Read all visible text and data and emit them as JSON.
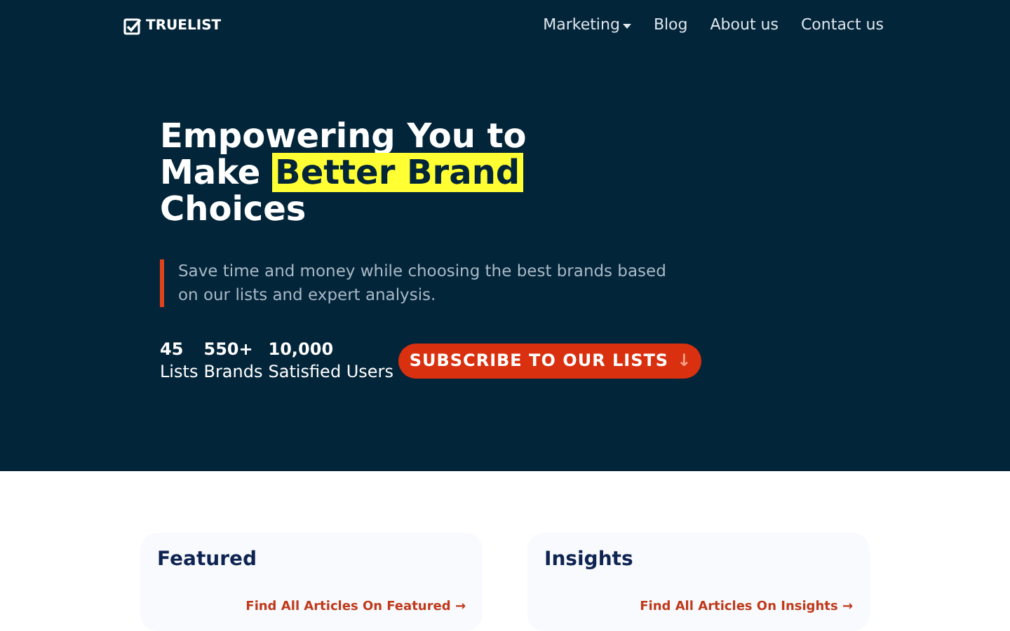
{
  "brand": {
    "name": "TRUELIST"
  },
  "nav": [
    {
      "label": "Marketing",
      "dropdown": true
    },
    {
      "label": "Blog",
      "dropdown": false
    },
    {
      "label": "About us",
      "dropdown": false
    },
    {
      "label": "Contact us",
      "dropdown": false
    }
  ],
  "hero": {
    "headline_before": "Empowering You to Make",
    "headline_highlight": "Better Brand",
    "headline_after": "Choices",
    "tagline": "Save time and money while choosing the best brands based on our lists and expert analysis.",
    "stats": [
      {
        "value": "45",
        "label": "Lists"
      },
      {
        "value": "550+",
        "label": "Brands"
      },
      {
        "value": "10,000",
        "label": "Satisfied Users"
      }
    ],
    "cta": {
      "label": "SUBSCRIBE TO OUR LISTS",
      "arrow": "↓"
    }
  },
  "sections": [
    {
      "title": "Featured",
      "link": "Find All Articles On Featured",
      "arrow": "→"
    },
    {
      "title": "Insights",
      "link": "Find All Articles On Insights",
      "arrow": "→"
    }
  ]
}
